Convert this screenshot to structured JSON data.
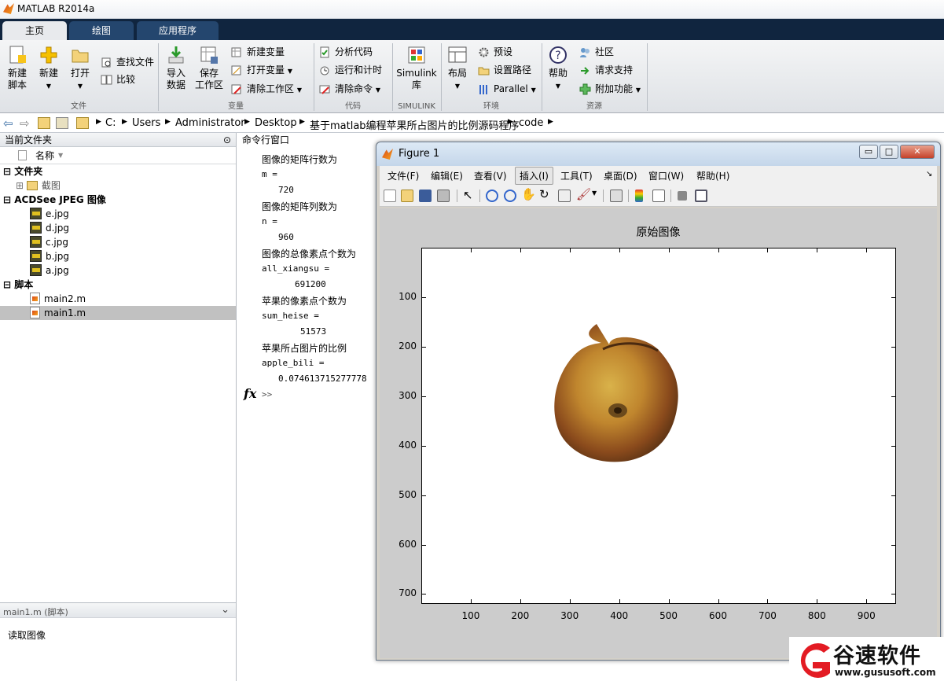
{
  "window": {
    "title": "MATLAB R2014a"
  },
  "tabs": [
    "主页",
    "绘图",
    "应用程序"
  ],
  "ribbon": {
    "new_script": "新建\n脚本",
    "new": "新建",
    "open": "打开",
    "find_files": "查找文件",
    "compare": "比较",
    "group_file": "文件",
    "import_data": "导入\n数据",
    "save_workspace": "保存\n工作区",
    "new_variable": "新建变量",
    "open_variable": "打开变量",
    "clear_workspace": "清除工作区",
    "group_variable": "变量",
    "analyze_code": "分析代码",
    "run_and_time": "运行和计时",
    "clear_commands": "清除命令",
    "group_code": "代码",
    "simulink_library": "Simulink\n库",
    "group_simulink": "SIMULINK",
    "layout": "布局",
    "preferences": "预设",
    "set_path": "设置路径",
    "parallel": "Parallel",
    "group_environment": "环境",
    "help": "帮助",
    "community": "社区",
    "request_support": "请求支持",
    "addons": "附加功能",
    "group_resources": "资源"
  },
  "address": {
    "path": [
      "C:",
      "Users",
      "Administrator",
      "Desktop",
      "基于matlab编程苹果所占图片的比例源码程序",
      "code"
    ]
  },
  "current_folder": {
    "title": "当前文件夹",
    "col_name": "名称",
    "groups": [
      {
        "label": "文件夹",
        "items": [
          "截图"
        ]
      },
      {
        "label": "ACDSee JPEG 图像",
        "items": [
          "e.jpg",
          "d.jpg",
          "c.jpg",
          "b.jpg",
          "a.jpg"
        ]
      },
      {
        "label": "脚本",
        "items": [
          "main2.m",
          "main1.m"
        ]
      }
    ],
    "selected": "main1.m"
  },
  "details": {
    "title": "main1.m (脚本)",
    "description": "读取图像"
  },
  "command_window": {
    "title": "命令行窗口",
    "lines": [
      "图像的矩阵行数为",
      "m =",
      "720",
      "图像的矩阵列数为",
      "n =",
      "960",
      "图像的总像素点个数为",
      "all_xiangsu =",
      "691200",
      "苹果的像素点个数为",
      "sum_heise =",
      "51573",
      "苹果所占图片的比例",
      "apple_bili =",
      "0.074613715277778"
    ],
    "prompt": ">>",
    "fx": "fx"
  },
  "figure": {
    "title": "Figure 1",
    "menu": [
      "文件(F)",
      "编辑(E)",
      "查看(V)",
      "插入(I)",
      "工具(T)",
      "桌面(D)",
      "窗口(W)",
      "帮助(H)"
    ],
    "axes_title": "原始图像",
    "x_ticks": [
      100,
      200,
      300,
      400,
      500,
      600,
      700,
      800,
      900
    ],
    "y_ticks": [
      100,
      200,
      300,
      400,
      500,
      600,
      700
    ],
    "xlim": [
      0,
      960
    ],
    "ylim": [
      0,
      720
    ]
  },
  "watermark": {
    "text": "谷速软件",
    "url": "www.gususoft.com"
  },
  "colors": {
    "tabbar": "#10253f",
    "accent": "#e31b23"
  }
}
